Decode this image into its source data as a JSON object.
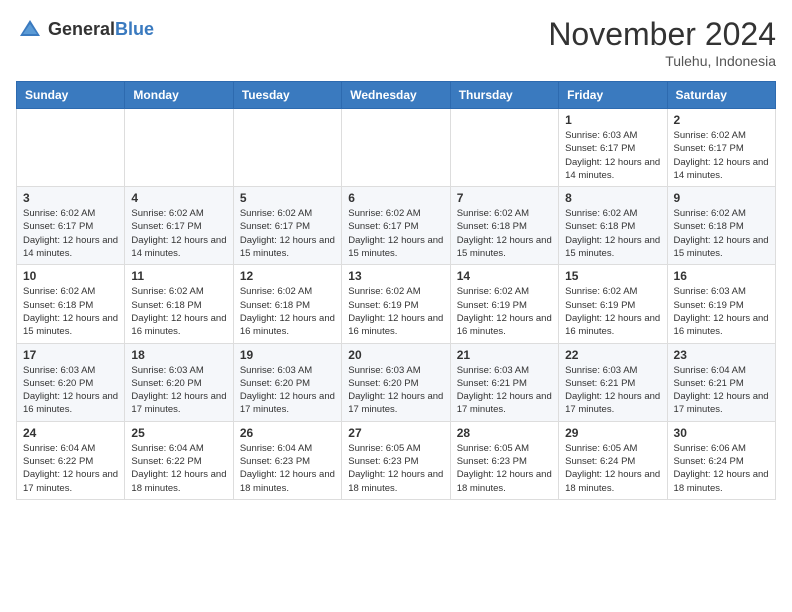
{
  "logo": {
    "text_general": "General",
    "text_blue": "Blue"
  },
  "title": "November 2024",
  "location": "Tulehu, Indonesia",
  "weekdays": [
    "Sunday",
    "Monday",
    "Tuesday",
    "Wednesday",
    "Thursday",
    "Friday",
    "Saturday"
  ],
  "weeks": [
    [
      {
        "day": "",
        "sunrise": "",
        "sunset": "",
        "daylight": ""
      },
      {
        "day": "",
        "sunrise": "",
        "sunset": "",
        "daylight": ""
      },
      {
        "day": "",
        "sunrise": "",
        "sunset": "",
        "daylight": ""
      },
      {
        "day": "",
        "sunrise": "",
        "sunset": "",
        "daylight": ""
      },
      {
        "day": "",
        "sunrise": "",
        "sunset": "",
        "daylight": ""
      },
      {
        "day": "1",
        "sunrise": "Sunrise: 6:03 AM",
        "sunset": "Sunset: 6:17 PM",
        "daylight": "Daylight: 12 hours and 14 minutes."
      },
      {
        "day": "2",
        "sunrise": "Sunrise: 6:02 AM",
        "sunset": "Sunset: 6:17 PM",
        "daylight": "Daylight: 12 hours and 14 minutes."
      }
    ],
    [
      {
        "day": "3",
        "sunrise": "Sunrise: 6:02 AM",
        "sunset": "Sunset: 6:17 PM",
        "daylight": "Daylight: 12 hours and 14 minutes."
      },
      {
        "day": "4",
        "sunrise": "Sunrise: 6:02 AM",
        "sunset": "Sunset: 6:17 PM",
        "daylight": "Daylight: 12 hours and 14 minutes."
      },
      {
        "day": "5",
        "sunrise": "Sunrise: 6:02 AM",
        "sunset": "Sunset: 6:17 PM",
        "daylight": "Daylight: 12 hours and 15 minutes."
      },
      {
        "day": "6",
        "sunrise": "Sunrise: 6:02 AM",
        "sunset": "Sunset: 6:17 PM",
        "daylight": "Daylight: 12 hours and 15 minutes."
      },
      {
        "day": "7",
        "sunrise": "Sunrise: 6:02 AM",
        "sunset": "Sunset: 6:18 PM",
        "daylight": "Daylight: 12 hours and 15 minutes."
      },
      {
        "day": "8",
        "sunrise": "Sunrise: 6:02 AM",
        "sunset": "Sunset: 6:18 PM",
        "daylight": "Daylight: 12 hours and 15 minutes."
      },
      {
        "day": "9",
        "sunrise": "Sunrise: 6:02 AM",
        "sunset": "Sunset: 6:18 PM",
        "daylight": "Daylight: 12 hours and 15 minutes."
      }
    ],
    [
      {
        "day": "10",
        "sunrise": "Sunrise: 6:02 AM",
        "sunset": "Sunset: 6:18 PM",
        "daylight": "Daylight: 12 hours and 15 minutes."
      },
      {
        "day": "11",
        "sunrise": "Sunrise: 6:02 AM",
        "sunset": "Sunset: 6:18 PM",
        "daylight": "Daylight: 12 hours and 16 minutes."
      },
      {
        "day": "12",
        "sunrise": "Sunrise: 6:02 AM",
        "sunset": "Sunset: 6:18 PM",
        "daylight": "Daylight: 12 hours and 16 minutes."
      },
      {
        "day": "13",
        "sunrise": "Sunrise: 6:02 AM",
        "sunset": "Sunset: 6:19 PM",
        "daylight": "Daylight: 12 hours and 16 minutes."
      },
      {
        "day": "14",
        "sunrise": "Sunrise: 6:02 AM",
        "sunset": "Sunset: 6:19 PM",
        "daylight": "Daylight: 12 hours and 16 minutes."
      },
      {
        "day": "15",
        "sunrise": "Sunrise: 6:02 AM",
        "sunset": "Sunset: 6:19 PM",
        "daylight": "Daylight: 12 hours and 16 minutes."
      },
      {
        "day": "16",
        "sunrise": "Sunrise: 6:03 AM",
        "sunset": "Sunset: 6:19 PM",
        "daylight": "Daylight: 12 hours and 16 minutes."
      }
    ],
    [
      {
        "day": "17",
        "sunrise": "Sunrise: 6:03 AM",
        "sunset": "Sunset: 6:20 PM",
        "daylight": "Daylight: 12 hours and 16 minutes."
      },
      {
        "day": "18",
        "sunrise": "Sunrise: 6:03 AM",
        "sunset": "Sunset: 6:20 PM",
        "daylight": "Daylight: 12 hours and 17 minutes."
      },
      {
        "day": "19",
        "sunrise": "Sunrise: 6:03 AM",
        "sunset": "Sunset: 6:20 PM",
        "daylight": "Daylight: 12 hours and 17 minutes."
      },
      {
        "day": "20",
        "sunrise": "Sunrise: 6:03 AM",
        "sunset": "Sunset: 6:20 PM",
        "daylight": "Daylight: 12 hours and 17 minutes."
      },
      {
        "day": "21",
        "sunrise": "Sunrise: 6:03 AM",
        "sunset": "Sunset: 6:21 PM",
        "daylight": "Daylight: 12 hours and 17 minutes."
      },
      {
        "day": "22",
        "sunrise": "Sunrise: 6:03 AM",
        "sunset": "Sunset: 6:21 PM",
        "daylight": "Daylight: 12 hours and 17 minutes."
      },
      {
        "day": "23",
        "sunrise": "Sunrise: 6:04 AM",
        "sunset": "Sunset: 6:21 PM",
        "daylight": "Daylight: 12 hours and 17 minutes."
      }
    ],
    [
      {
        "day": "24",
        "sunrise": "Sunrise: 6:04 AM",
        "sunset": "Sunset: 6:22 PM",
        "daylight": "Daylight: 12 hours and 17 minutes."
      },
      {
        "day": "25",
        "sunrise": "Sunrise: 6:04 AM",
        "sunset": "Sunset: 6:22 PM",
        "daylight": "Daylight: 12 hours and 18 minutes."
      },
      {
        "day": "26",
        "sunrise": "Sunrise: 6:04 AM",
        "sunset": "Sunset: 6:23 PM",
        "daylight": "Daylight: 12 hours and 18 minutes."
      },
      {
        "day": "27",
        "sunrise": "Sunrise: 6:05 AM",
        "sunset": "Sunset: 6:23 PM",
        "daylight": "Daylight: 12 hours and 18 minutes."
      },
      {
        "day": "28",
        "sunrise": "Sunrise: 6:05 AM",
        "sunset": "Sunset: 6:23 PM",
        "daylight": "Daylight: 12 hours and 18 minutes."
      },
      {
        "day": "29",
        "sunrise": "Sunrise: 6:05 AM",
        "sunset": "Sunset: 6:24 PM",
        "daylight": "Daylight: 12 hours and 18 minutes."
      },
      {
        "day": "30",
        "sunrise": "Sunrise: 6:06 AM",
        "sunset": "Sunset: 6:24 PM",
        "daylight": "Daylight: 12 hours and 18 minutes."
      }
    ]
  ]
}
